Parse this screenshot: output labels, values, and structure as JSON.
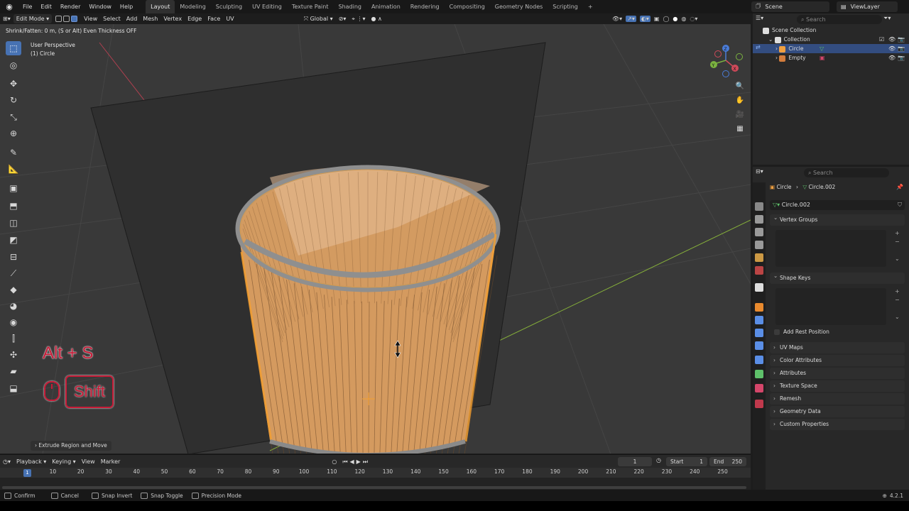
{
  "app": {
    "menus": [
      "File",
      "Edit",
      "Render",
      "Window",
      "Help"
    ],
    "workspaces": [
      "Layout",
      "Modeling",
      "Sculpting",
      "UV Editing",
      "Texture Paint",
      "Shading",
      "Animation",
      "Rendering",
      "Compositing",
      "Geometry Nodes",
      "Scripting"
    ],
    "active_workspace": "Layout",
    "add_tab": "+",
    "scene": "Scene",
    "view_layer": "ViewLayer"
  },
  "viewport_header": {
    "mode": "Edit Mode",
    "menus": [
      "View",
      "Select",
      "Add",
      "Mesh",
      "Vertex",
      "Edge",
      "Face",
      "UV"
    ],
    "orientation": "Global"
  },
  "viewport": {
    "hint": "Shrink/Fatten: 0 m, (S or Alt) Even Thickness OFF",
    "perspective": "User Perspective",
    "object": "(1) Circle",
    "last_operation": "Extrude Region and Move",
    "gizmo_axes": [
      "X",
      "Y",
      "Z"
    ]
  },
  "key_overlay": {
    "combo": "Alt + S",
    "modifier": "Shift"
  },
  "timeline": {
    "menus": [
      "Playback",
      "Keying",
      "View",
      "Marker"
    ],
    "current_frame": "1",
    "start_label": "Start",
    "start": "1",
    "end_label": "End",
    "end": "250",
    "ticks": [
      "10",
      "20",
      "30",
      "40",
      "50",
      "60",
      "70",
      "80",
      "90",
      "100",
      "110",
      "120",
      "130",
      "140",
      "150",
      "160",
      "170",
      "180",
      "190",
      "200",
      "210",
      "220",
      "230",
      "240",
      "250"
    ]
  },
  "statusbar": {
    "items": [
      "Confirm",
      "Cancel",
      "Snap Invert",
      "Snap Toggle",
      "Precision Mode"
    ],
    "version": "4.2.1"
  },
  "outliner": {
    "search_placeholder": "Search",
    "rows": [
      "Scene Collection",
      "Collection",
      "Circle",
      "Empty"
    ]
  },
  "properties": {
    "search_placeholder": "Search",
    "breadcrumb_object": "Circle",
    "breadcrumb_mesh": "Circle.002",
    "mesh_name": "Circle.002",
    "panels": {
      "vertex_groups": "Vertex Groups",
      "shape_keys": "Shape Keys",
      "add_rest_position": "Add Rest Position",
      "uv_maps": "UV Maps",
      "color_attributes": "Color Attributes",
      "attributes": "Attributes",
      "texture_space": "Texture Space",
      "remesh": "Remesh",
      "geometry_data": "Geometry Data",
      "custom_properties": "Custom Properties"
    }
  },
  "colors": {
    "accent": "#4772b3",
    "selection_orange": "#f5a030",
    "overlay_red": "#c61b37"
  }
}
